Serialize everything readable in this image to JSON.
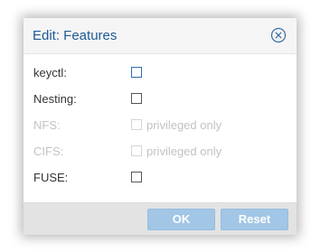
{
  "dialog": {
    "title": "Edit: Features",
    "close_icon": "close-circle-icon"
  },
  "fields": [
    {
      "label": "keyctl:",
      "checked": false,
      "disabled": false,
      "focused": true,
      "box_label": ""
    },
    {
      "label": "Nesting:",
      "checked": false,
      "disabled": false,
      "focused": false,
      "box_label": ""
    },
    {
      "label": "NFS:",
      "checked": false,
      "disabled": true,
      "focused": false,
      "box_label": "privileged only"
    },
    {
      "label": "CIFS:",
      "checked": false,
      "disabled": true,
      "focused": false,
      "box_label": "privileged only"
    },
    {
      "label": "FUSE:",
      "checked": false,
      "disabled": false,
      "focused": false,
      "box_label": ""
    }
  ],
  "buttons": {
    "ok_label": "OK",
    "reset_label": "Reset"
  },
  "colors": {
    "title": "#1f5a94",
    "button_bg": "#a2c6e6",
    "disabled_text": "#c2c2c2"
  }
}
